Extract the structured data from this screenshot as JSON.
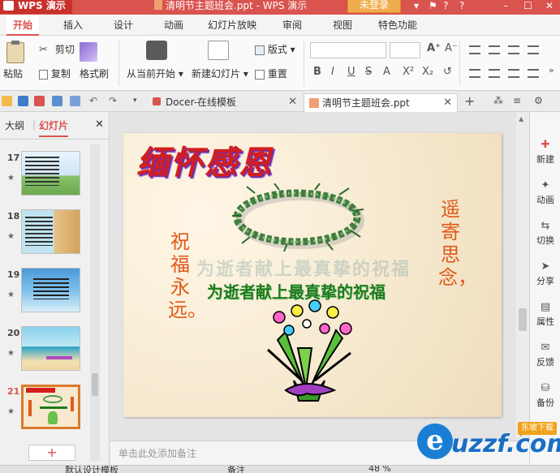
{
  "titlebar": {
    "app_name": "WPS 演示",
    "doc_title": "清明节主题班会.ppt - WPS 演示",
    "login_label": "未登录",
    "controls": [
      "?",
      "?",
      "–",
      "☐",
      "✕"
    ]
  },
  "tabs": [
    "开始",
    "插入",
    "设计",
    "动画",
    "幻灯片放映",
    "审阅",
    "视图",
    "特色功能"
  ],
  "ribbon": {
    "paste": "粘贴",
    "cut": "剪切",
    "copy": "复制",
    "format_painter": "格式刷",
    "from_current": "从当前开始",
    "new_slide": "新建幻灯片",
    "layout": "版式",
    "reset": "重置"
  },
  "doc_tabs": [
    {
      "label": "Docer-在线模板",
      "active": false
    },
    {
      "label": "清明节主题班会.ppt",
      "active": true
    }
  ],
  "left_panel": {
    "tab_outline": "大纲",
    "tab_slides": "幻灯片",
    "close": "✕",
    "slides": [
      {
        "number": "17",
        "star": "★"
      },
      {
        "number": "18",
        "star": "★"
      },
      {
        "number": "19",
        "star": "★"
      },
      {
        "number": "20",
        "star": "★"
      },
      {
        "number": "21",
        "star": "★",
        "selected": true
      }
    ],
    "add_button": "+"
  },
  "slide": {
    "title": "缅怀感恩",
    "left_vertical": "祝福永远。",
    "right_vertical": "遥寄思念，",
    "ghost_text": "为逝者献上最真挚的祝福",
    "caption": "为逝者献上最真挚的祝福"
  },
  "notes_placeholder": "单击此处添加备注",
  "right_toolbar": [
    "新建",
    "动画",
    "切换",
    "分享",
    "属性",
    "反馈",
    "备份"
  ],
  "statusbar": {
    "theme": "默认设计模板",
    "notes": "备注",
    "zoom": "48 %"
  },
  "watermark": {
    "brand": "uzzf.com",
    "tag": "东坡下载"
  },
  "colors": {
    "accent": "#d9534f",
    "title_red": "#d31e1e",
    "caption_green": "#1d7a1d",
    "vertical_orange": "#e05a1a"
  }
}
